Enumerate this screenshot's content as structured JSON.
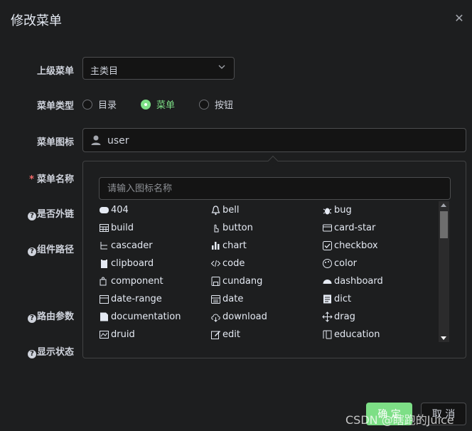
{
  "dialog": {
    "title": "修改菜单",
    "close_icon": "close-icon"
  },
  "form": {
    "parent_label": "上级菜单",
    "parent_value": "主类目",
    "type_label": "菜单类型",
    "type_options": [
      "目录",
      "菜单",
      "按钮"
    ],
    "type_selected": "菜单",
    "icon_label": "菜单图标",
    "icon_value": "user",
    "name_label": "菜单名称",
    "external_label": "是否外链",
    "component_label": "组件路径",
    "route_params_label": "路由参数",
    "display_label": "显示状态"
  },
  "icon_picker": {
    "search_placeholder": "请输入图标名称",
    "icons": [
      [
        "404",
        "bell",
        "bug"
      ],
      [
        "build",
        "button",
        "card-star"
      ],
      [
        "cascader",
        "chart",
        "checkbox"
      ],
      [
        "clipboard",
        "code",
        "color"
      ],
      [
        "component",
        "cundang",
        "dashboard"
      ],
      [
        "date-range",
        "date",
        "dict"
      ],
      [
        "documentation",
        "download",
        "drag"
      ],
      [
        "druid",
        "edit",
        "education"
      ]
    ]
  },
  "footer": {
    "confirm_label": "确 定",
    "cancel_label": "取 消"
  },
  "watermark": "CSDN @瞎跑的Juice",
  "colors": {
    "accent": "#7ddf86",
    "background": "#1d1e1f",
    "required": "#f56c6c"
  }
}
